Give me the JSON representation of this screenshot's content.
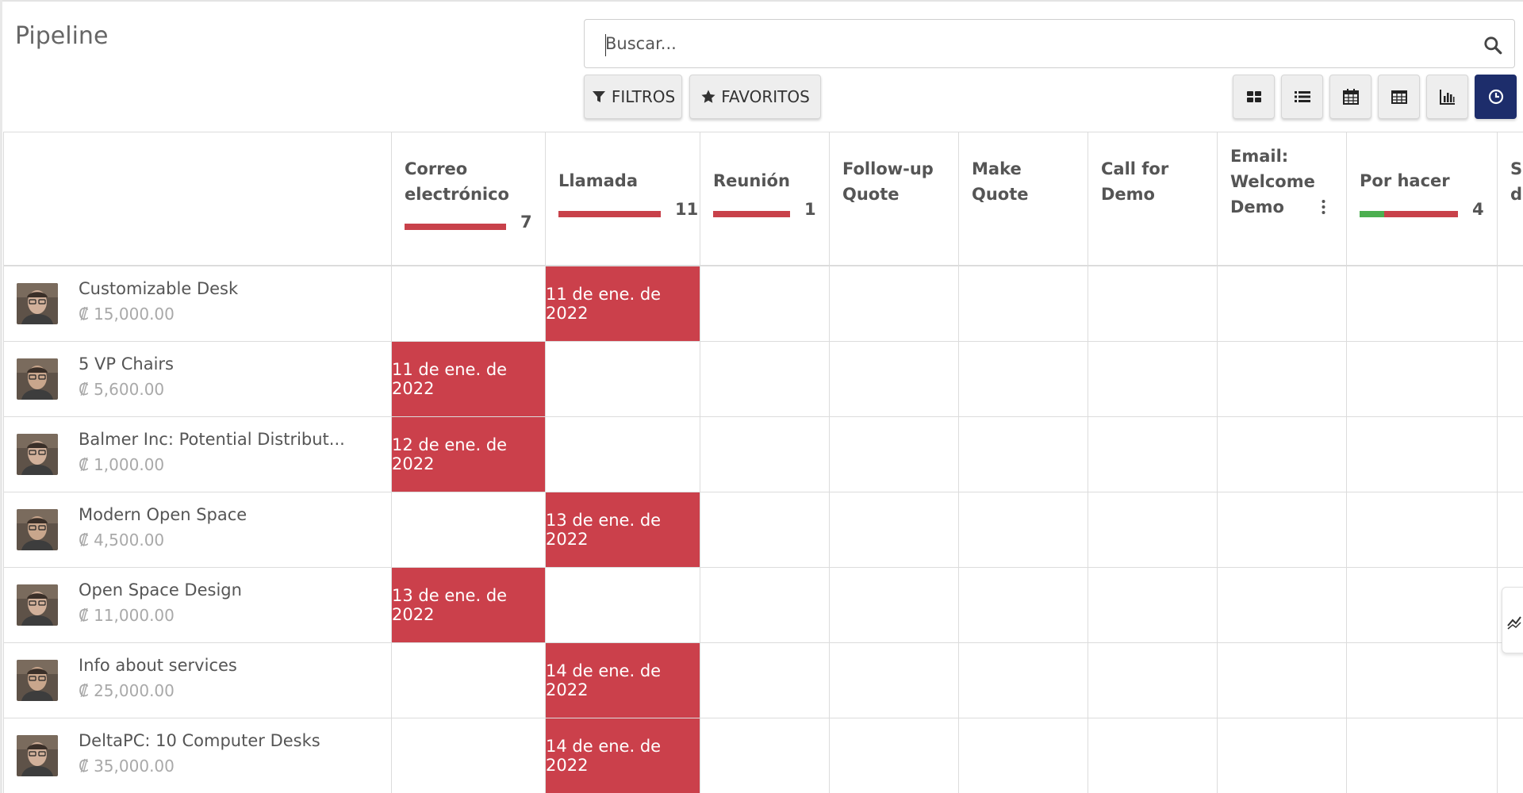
{
  "page": {
    "title": "Pipeline"
  },
  "search": {
    "placeholder": "Buscar...",
    "icon": "search-icon"
  },
  "toolbar": {
    "filters_label": "FILTROS",
    "favorites_label": "FAVORITOS",
    "views": [
      {
        "name": "kanban",
        "icon": "kanban-icon"
      },
      {
        "name": "list",
        "icon": "list-icon"
      },
      {
        "name": "calendar",
        "icon": "calendar-icon"
      },
      {
        "name": "pivot",
        "icon": "table-icon"
      },
      {
        "name": "graph",
        "icon": "bar-chart-icon"
      },
      {
        "name": "activity",
        "icon": "clock-icon",
        "active": true
      }
    ]
  },
  "columns": [
    {
      "label": "Correo electrónico",
      "count": "7",
      "progress_red": 1.0,
      "progress_green": 0.0
    },
    {
      "label": "Llamada",
      "count": "11",
      "progress_red": 1.0,
      "progress_green": 0.0
    },
    {
      "label": "Reunión",
      "count": "1",
      "progress_red": 1.0,
      "progress_green": 0.0
    },
    {
      "label": "Follow-up Quote",
      "count": ""
    },
    {
      "label": "Make Quote",
      "count": ""
    },
    {
      "label": "Call for Demo",
      "count": ""
    },
    {
      "label": "Email: Welcome Demo",
      "count": "",
      "has_menu": true
    },
    {
      "label": "Por hacer",
      "count": "4",
      "progress_red": 0.75,
      "progress_green": 0.25
    },
    {
      "label": "S d",
      "count": ""
    }
  ],
  "rows": [
    {
      "name": "Customizable Desk",
      "amount": "₡ 15,000.00",
      "due": {
        "column": 1,
        "date": "11 de ene. de 2022"
      }
    },
    {
      "name": "5 VP Chairs",
      "amount": "₡ 5,600.00",
      "due": {
        "column": 0,
        "date": "11 de ene. de 2022"
      }
    },
    {
      "name": "Balmer Inc: Potential Distribut...",
      "amount": "₡ 1,000.00",
      "due": {
        "column": 0,
        "date": "12 de ene. de 2022"
      }
    },
    {
      "name": "Modern Open Space",
      "amount": "₡ 4,500.00",
      "due": {
        "column": 1,
        "date": "13 de ene. de 2022"
      }
    },
    {
      "name": "Open Space Design",
      "amount": "₡ 11,000.00",
      "due": {
        "column": 0,
        "date": "13 de ene. de 2022"
      }
    },
    {
      "name": "Info about services",
      "amount": "₡ 25,000.00",
      "due": {
        "column": 1,
        "date": "14 de ene. de 2022"
      }
    },
    {
      "name": "DeltaPC: 10 Computer Desks",
      "amount": "₡ 35,000.00",
      "due": {
        "column": 1,
        "date": "14 de ene. de 2022"
      }
    }
  ],
  "colors": {
    "overdue": "#cb404b",
    "done": "#4caf50",
    "active_view": "#1d2d6b"
  }
}
